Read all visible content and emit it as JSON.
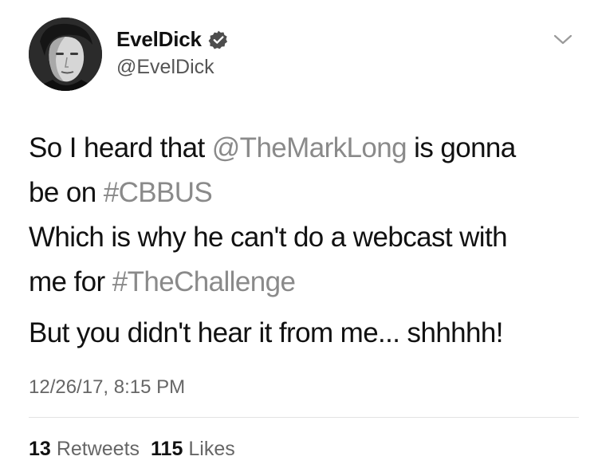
{
  "user": {
    "display_name": "EvelDick",
    "handle": "@EvelDick",
    "verified": true
  },
  "icons": {
    "verified": "verified-badge-icon",
    "menu": "chevron-down-icon"
  },
  "tweet": {
    "segments": {
      "l1_a": "So I heard that ",
      "l1_mention": "@TheMarkLong",
      "l1_b": " is gonna",
      "l2_a": "be on ",
      "l2_hashtag": "#CBBUS",
      "l3": "Which is why he can't do a webcast with",
      "l4_a": "me for ",
      "l4_hashtag": "#TheChallenge",
      "l5": "But you didn't hear it from me... shhhhh!"
    },
    "timestamp": "12/26/17, 8:15 PM"
  },
  "stats": {
    "retweets_count": "13",
    "retweets_label": "Retweets",
    "likes_count": "115",
    "likes_label": "Likes"
  },
  "colors": {
    "link": "#8a8a8a",
    "text": "#111111",
    "secondary": "#666666"
  }
}
